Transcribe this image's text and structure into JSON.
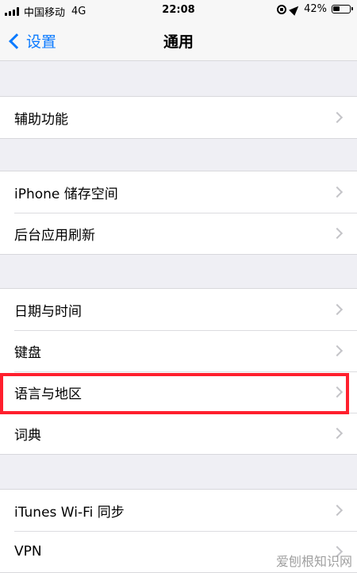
{
  "status_bar": {
    "carrier": "中国移动",
    "network": "4G",
    "time": "22:08",
    "battery_percent": "42%",
    "battery_level": 0.42,
    "icons": [
      "signal-icon",
      "rotation-lock-icon",
      "location-icon",
      "battery-icon"
    ]
  },
  "nav": {
    "back_label": "设置",
    "title": "通用"
  },
  "sections": [
    {
      "rows": [
        {
          "label": "辅助功能"
        }
      ]
    },
    {
      "rows": [
        {
          "label": "iPhone 储存空间"
        },
        {
          "label": "后台应用刷新"
        }
      ]
    },
    {
      "rows": [
        {
          "label": "日期与时间"
        },
        {
          "label": "键盘"
        },
        {
          "label": "语言与地区",
          "highlighted": true
        },
        {
          "label": "词典"
        }
      ]
    },
    {
      "rows": [
        {
          "label": "iTunes Wi-Fi 同步"
        },
        {
          "label": "VPN"
        }
      ]
    }
  ],
  "colors": {
    "accent": "#0a7aff",
    "highlight": "#ff1f2d",
    "background": "#efeff4"
  },
  "watermark": "爱刨根知识网"
}
